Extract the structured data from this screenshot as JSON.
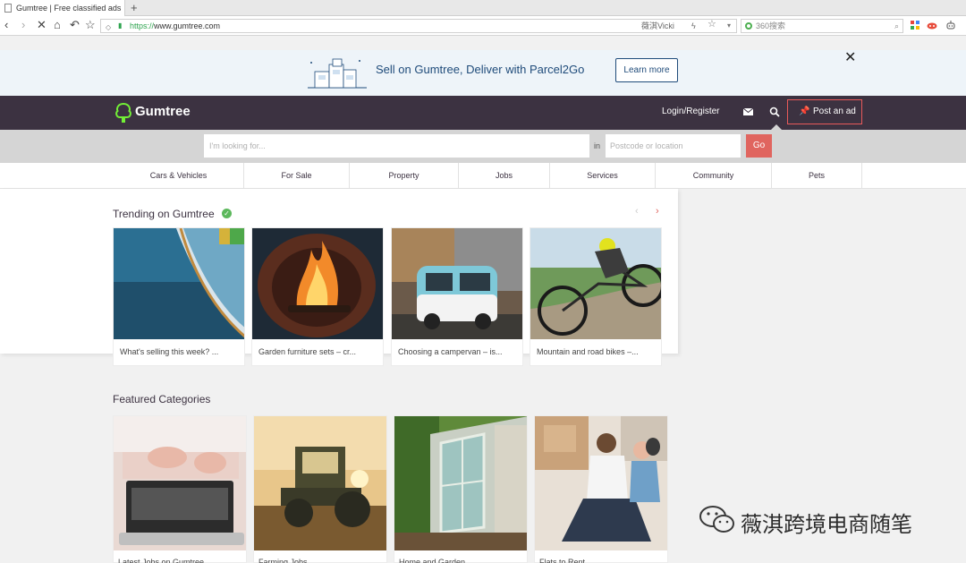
{
  "browser": {
    "tab_title": "Gumtree | Free classified ads",
    "new_tab_label": "+",
    "url_protocol": "https://",
    "url_host": "www.gumtree.com",
    "user_name": "薇淇Vicki",
    "search_placeholder": "360搜索"
  },
  "promo": {
    "text": "Sell on Gumtree, Deliver with Parcel2Go",
    "button_label": "Learn more",
    "close_label": "✕"
  },
  "header": {
    "logo_text": "Gumtree",
    "login_label": "Login/Register",
    "post_ad_label": "Post an ad",
    "accent_color": "#e0655f",
    "bg_color": "#3c3241"
  },
  "search": {
    "query_placeholder": "I'm looking for...",
    "in_label": "in",
    "location_placeholder": "Postcode or location",
    "go_label": "Go"
  },
  "categories": [
    "Cars & Vehicles",
    "For Sale",
    "Property",
    "Jobs",
    "Services",
    "Community",
    "Pets"
  ],
  "trending": {
    "title": "Trending on Gumtree",
    "prev_label": "‹",
    "next_label": "›",
    "cards": [
      {
        "caption": "What's selling this week? ..."
      },
      {
        "caption": "Garden furniture sets – cr..."
      },
      {
        "caption": "Choosing a campervan – is..."
      },
      {
        "caption": "Mountain and road bikes –..."
      }
    ]
  },
  "featured": {
    "title": "Featured Categories",
    "cards": [
      {
        "caption": "Latest Jobs on Gumtree"
      },
      {
        "caption": "Farming Jobs"
      },
      {
        "caption": "Home and Garden"
      },
      {
        "caption": "Flats to Rent"
      }
    ]
  },
  "watermark": {
    "text": "薇淇跨境电商随笔"
  }
}
